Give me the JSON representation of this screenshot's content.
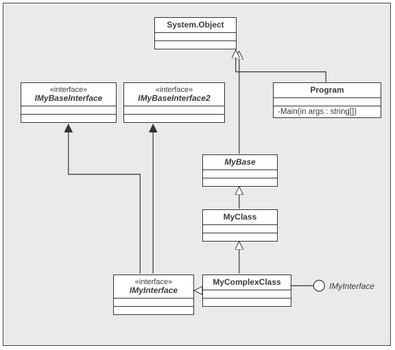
{
  "classes": {
    "system_object": {
      "name": "System.Object",
      "stereotype": null,
      "italic": false,
      "attrs": "",
      "ops": ""
    },
    "imybaseinterface": {
      "name": "IMyBaseInterface",
      "stereotype": "«interface»",
      "italic": true,
      "attrs": "",
      "ops": ""
    },
    "imybaseinterface2": {
      "name": "IMyBaseInterface2",
      "stereotype": "«interface»",
      "italic": true,
      "attrs": "",
      "ops": ""
    },
    "program": {
      "name": "Program",
      "stereotype": null,
      "italic": false,
      "attrs": "",
      "ops": "-Main(in args : string[])"
    },
    "mybase": {
      "name": "MyBase",
      "stereotype": null,
      "italic": true,
      "attrs": "",
      "ops": ""
    },
    "myclass": {
      "name": "MyClass",
      "stereotype": null,
      "italic": false,
      "attrs": "",
      "ops": ""
    },
    "imyinterface": {
      "name": "IMyInterface",
      "stereotype": "«interface»",
      "italic": true,
      "attrs": "",
      "ops": ""
    },
    "mycomplexclass": {
      "name": "MyComplexClass",
      "stereotype": null,
      "italic": false,
      "attrs": "",
      "ops": ""
    }
  },
  "lollipop_label": "IMyInterface",
  "chart_data": {
    "type": "uml_class_diagram",
    "classes": [
      {
        "id": "system_object",
        "name": "System.Object",
        "stereotype": null,
        "abstract": false,
        "operations": []
      },
      {
        "id": "imybaseinterface",
        "name": "IMyBaseInterface",
        "stereotype": "interface",
        "abstract": false,
        "operations": []
      },
      {
        "id": "imybaseinterface2",
        "name": "IMyBaseInterface2",
        "stereotype": "interface",
        "abstract": false,
        "operations": []
      },
      {
        "id": "program",
        "name": "Program",
        "stereotype": null,
        "abstract": false,
        "operations": [
          "-Main(in args : string[])"
        ]
      },
      {
        "id": "mybase",
        "name": "MyBase",
        "stereotype": null,
        "abstract": true,
        "operations": []
      },
      {
        "id": "myclass",
        "name": "MyClass",
        "stereotype": null,
        "abstract": false,
        "operations": []
      },
      {
        "id": "imyinterface",
        "name": "IMyInterface",
        "stereotype": "interface",
        "abstract": false,
        "operations": []
      },
      {
        "id": "mycomplexclass",
        "name": "MyComplexClass",
        "stereotype": null,
        "abstract": false,
        "operations": []
      }
    ],
    "relationships": [
      {
        "from": "program",
        "to": "system_object",
        "type": "generalization"
      },
      {
        "from": "mybase",
        "to": "system_object",
        "type": "generalization"
      },
      {
        "from": "myclass",
        "to": "mybase",
        "type": "generalization"
      },
      {
        "from": "mycomplexclass",
        "to": "myclass",
        "type": "generalization"
      },
      {
        "from": "mycomplexclass",
        "to": "imyinterface",
        "type": "realization"
      },
      {
        "from": "imyinterface",
        "to": "imybaseinterface",
        "type": "generalization"
      },
      {
        "from": "imyinterface",
        "to": "imybaseinterface2",
        "type": "generalization"
      },
      {
        "from": "mycomplexclass",
        "provides": "IMyInterface",
        "type": "provided_interface_lollipop"
      }
    ]
  }
}
